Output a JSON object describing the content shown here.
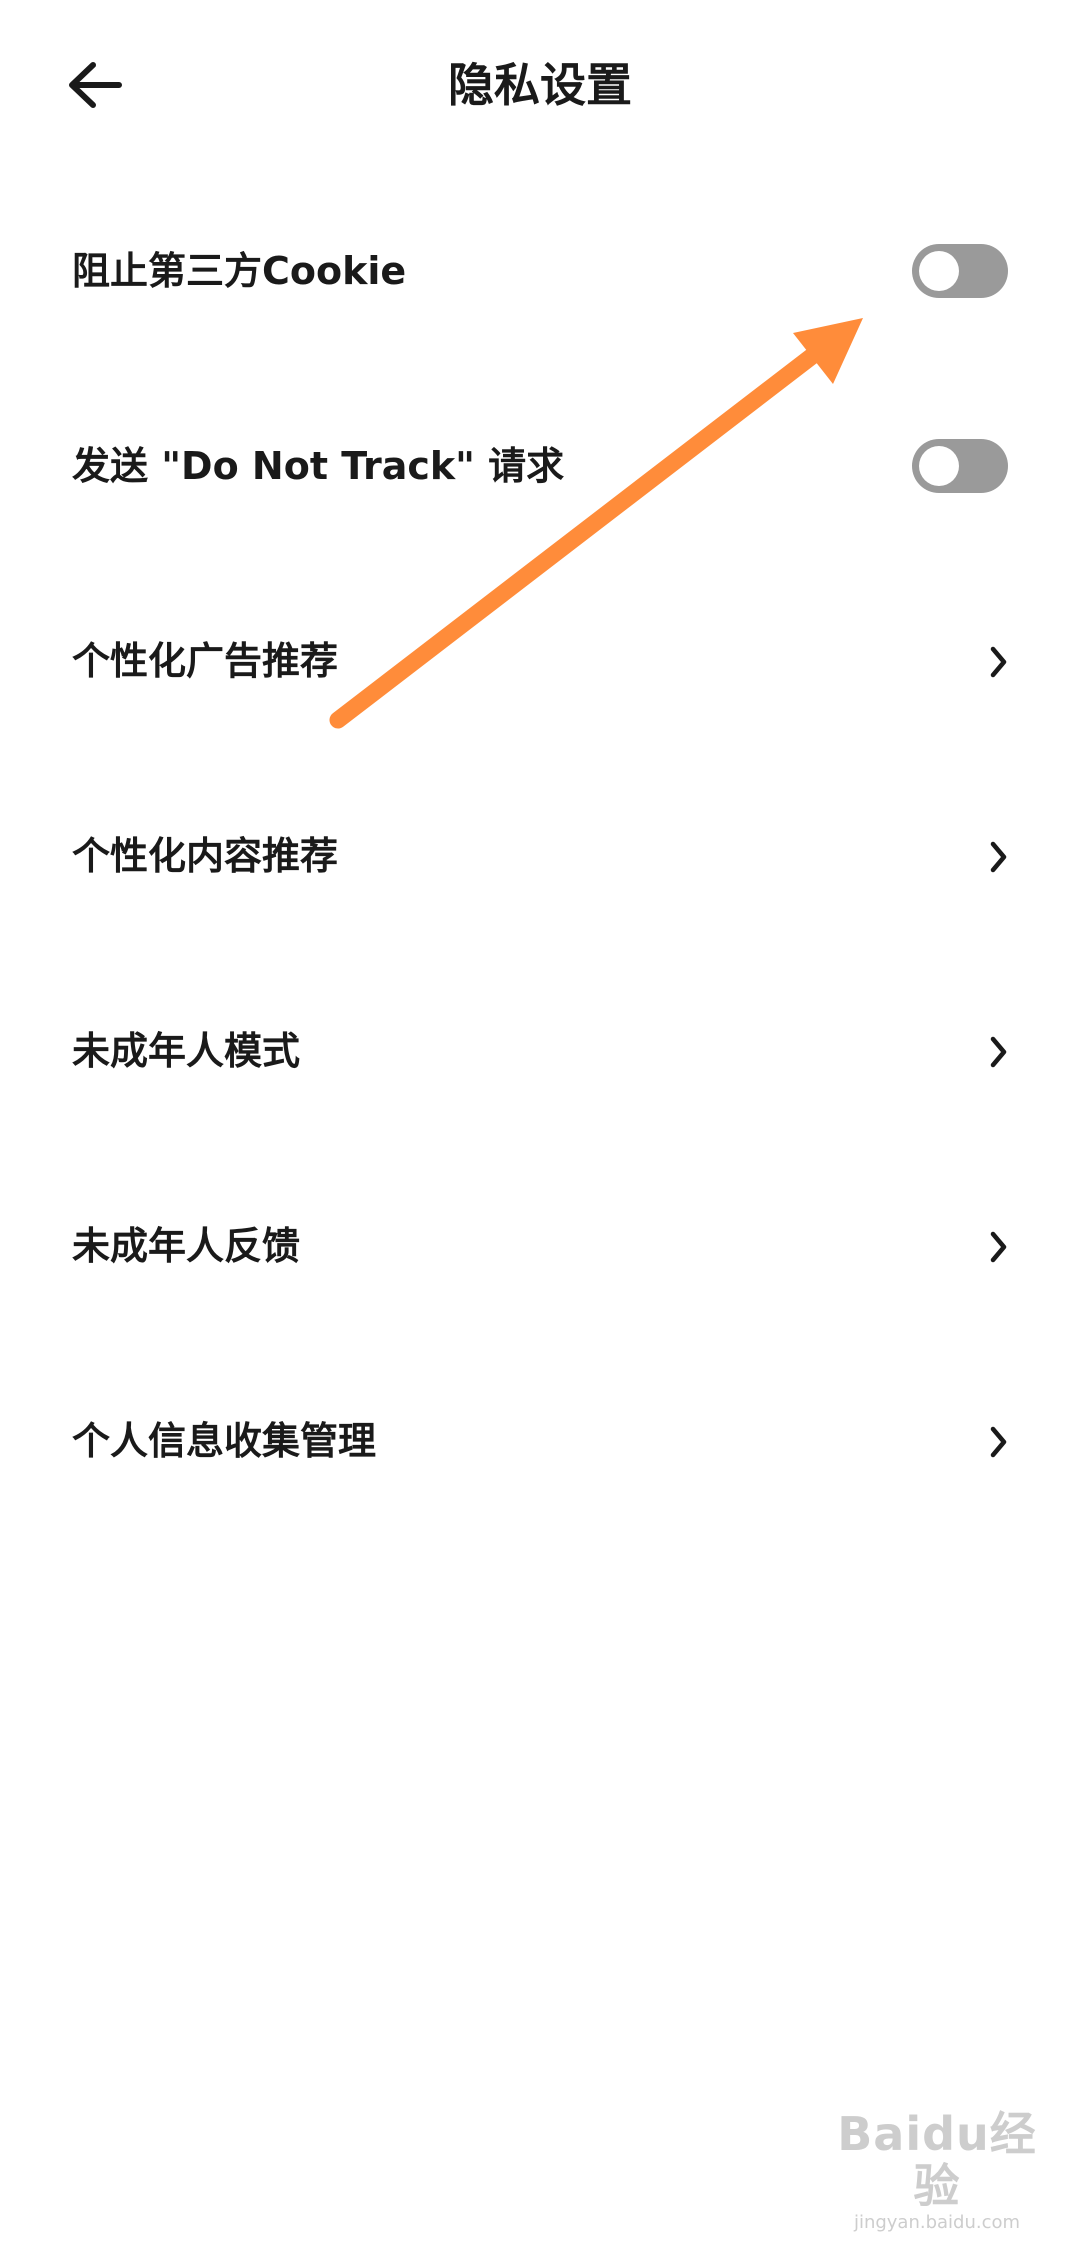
{
  "header": {
    "title": "隐私设置",
    "back_icon": "arrow-left-icon"
  },
  "settings": [
    {
      "id": "block-third-party-cookie",
      "label": "阻止第三方Cookie",
      "control": "toggle",
      "on": false
    },
    {
      "id": "do-not-track",
      "label": "发送 \"Do Not Track\" 请求",
      "control": "toggle",
      "on": false
    },
    {
      "id": "personalized-ads",
      "label": "个性化广告推荐",
      "control": "chevron"
    },
    {
      "id": "personalized-content",
      "label": "个性化内容推荐",
      "control": "chevron"
    },
    {
      "id": "minor-mode",
      "label": "未成年人模式",
      "control": "chevron"
    },
    {
      "id": "minor-feedback",
      "label": "未成年人反馈",
      "control": "chevron"
    },
    {
      "id": "personal-info-collection",
      "label": "个人信息收集管理",
      "control": "chevron"
    }
  ],
  "annotation": {
    "type": "arrow",
    "color": "#FF8C3A",
    "points_to": "block-third-party-cookie toggle"
  },
  "colors": {
    "toggle_off": "#9A9A9A",
    "text": "#1A1A1A",
    "background": "#FFFFFF"
  },
  "watermark": {
    "logo": "Baidu经验",
    "url": "jingyan.baidu.com"
  }
}
